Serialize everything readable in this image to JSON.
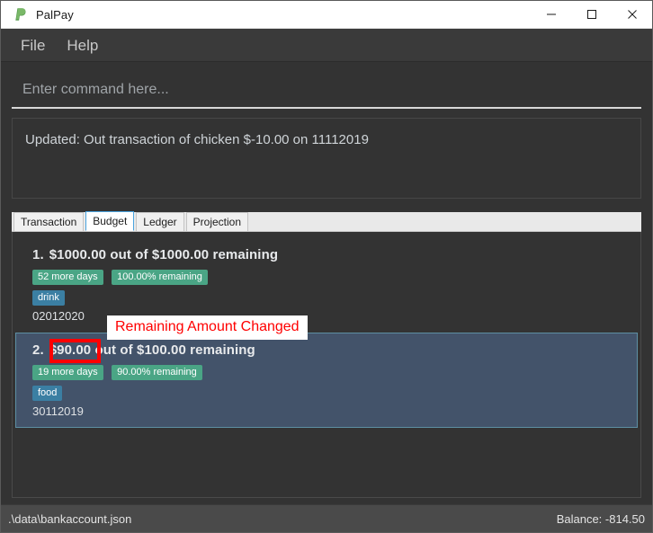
{
  "window": {
    "title": "PalPay",
    "icon": "palpay-logo-icon",
    "minimize_label": "—",
    "maximize_label": "☐",
    "close_label": "✕"
  },
  "menu": {
    "items": [
      {
        "label": "File"
      },
      {
        "label": "Help"
      }
    ]
  },
  "command": {
    "value": "",
    "placeholder": "Enter command here..."
  },
  "result": {
    "text": "Updated: Out transaction of chicken $-10.00 on 11112019"
  },
  "tabs": [
    {
      "label": "Transaction",
      "active": false
    },
    {
      "label": "Budget",
      "active": true
    },
    {
      "label": "Ledger",
      "active": false
    },
    {
      "label": "Projection",
      "active": false
    }
  ],
  "budget_list": {
    "items": [
      {
        "index": "1.",
        "amount": "$1000.00",
        "rest": "out of $1000.00 remaining",
        "days_tag": "52 more days",
        "percent_tag": "100.00% remaining",
        "category_tag": "drink",
        "date": "02012020",
        "selected": false
      },
      {
        "index": "2.",
        "amount": "$90.00",
        "rest": "out of $100.00 remaining",
        "days_tag": "19 more days",
        "percent_tag": "90.00% remaining",
        "category_tag": "food",
        "date": "30112019",
        "selected": true
      }
    ]
  },
  "annotation": {
    "label": "Remaining Amount Changed",
    "color": "#ff0000",
    "highlight_target": "$90.00"
  },
  "status_bar": {
    "file_path": ".\\data\\bankaccount.json",
    "balance": "Balance: -814.50"
  },
  "colors": {
    "window_bg": "#333333",
    "titlebar_bg": "#ffffff",
    "menubar_bg": "#3a3a3a",
    "tag_green": "#4aa585",
    "tag_blue": "#3b7fa3",
    "selected_item_bg": "#43536a",
    "selected_item_border": "#5d8fa3",
    "active_tab_border": "#4aa3df",
    "annotation_red": "#ff0000",
    "statusbar_bg": "#4a4a4a"
  }
}
